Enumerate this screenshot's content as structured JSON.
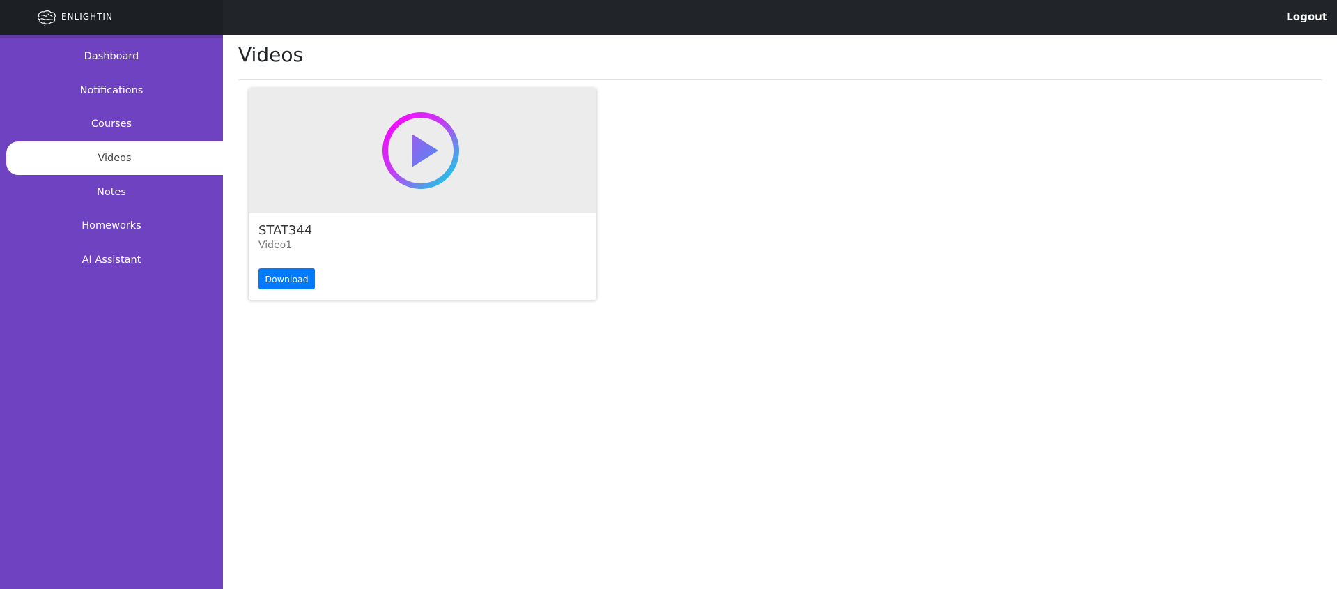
{
  "app": {
    "brand": "ENLIGHTIN"
  },
  "header": {
    "logout_label": "Logout"
  },
  "sidebar": {
    "items": [
      {
        "label": "Dashboard"
      },
      {
        "label": "Notifications"
      },
      {
        "label": "Courses"
      },
      {
        "label": "Videos"
      },
      {
        "label": "Notes"
      },
      {
        "label": "Homeworks"
      },
      {
        "label": "AI Assistant"
      }
    ],
    "active_label": "Videos"
  },
  "main": {
    "title": "Videos",
    "videos": [
      {
        "course": "STAT344",
        "name": "Video1",
        "download_label": "Download"
      }
    ]
  },
  "icons": {
    "brand": "brain-icon",
    "thumbnail": "play-circle-icon"
  },
  "colors": {
    "sidebar": "#6f42c1",
    "topbar": "#212429",
    "primary_button": "#007bff",
    "play_gradient_start": "#ff00ff",
    "play_gradient_end": "#00e0e0"
  }
}
